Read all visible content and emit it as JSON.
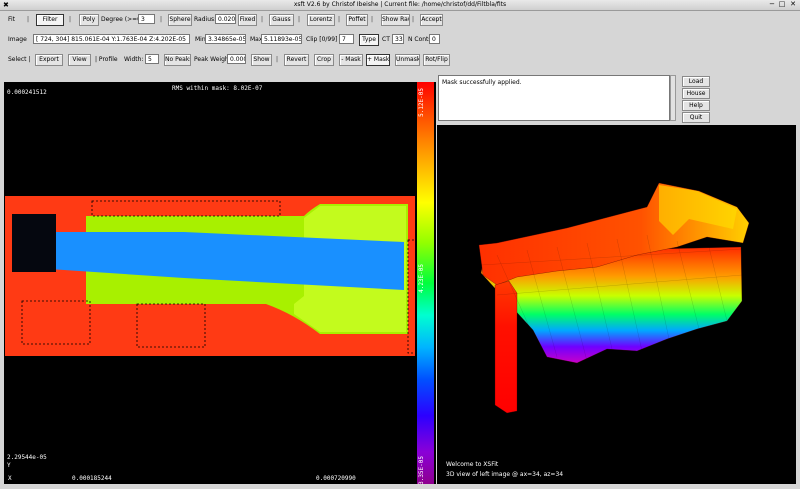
{
  "window": {
    "title": "xsft V2.6 by Christof Ibeishe   |   Current file: /home/christof/dd/Filtbla/fits",
    "min_glyph": "−",
    "max_glyph": "□",
    "close_glyph": "✕",
    "app_glyph": "✖"
  },
  "toolbar1": {
    "fit_label": "Fit",
    "filter_label": "Filter",
    "poly_label": "Poly",
    "degree_label": "Degree (>=0):",
    "degree_value": "3",
    "sphere_label": "Sphere",
    "radius_label": "Radius:",
    "radius_value": "0.020",
    "fixed_label": "Fixed",
    "gauss_label": "Gauss",
    "lorentz_label": "Lorentz",
    "poffet_label": "Poffet",
    "show_raw_label": "Show Raw",
    "accept_label": "Accept",
    "sep": "|"
  },
  "toolbar2": {
    "image_label": "Image",
    "coords_value": "[ 724, 304]  815.061E-04 Y:1.763E-04 Z:4.202E-05",
    "min_label": "Min",
    "min_value": "3.34865e-05",
    "max_label": "Max",
    "max_value": "5.11893e-05",
    "clip_label": "Clip [0/99]",
    "clip_value": "7",
    "type_label": "Type",
    "ct_label": "CT",
    "ct_value": "33",
    "ncont_label": "N Conts",
    "ncont_value": "0"
  },
  "toolbar3": {
    "select_label": "Select |",
    "export_label": "Export",
    "view_label": "View",
    "profile_label": "| Profile",
    "width_label": "Width:",
    "width_value": "5",
    "no_peaks_label": "No Peaks",
    "peak_weight_label": "Peak Weight:",
    "peak_weight_value": "0.000",
    "show_label": "Show",
    "revert_label": "Revert",
    "crop_label": "Crop",
    "minus_mask_label": "- Mask",
    "plus_mask_label": "+ Mask",
    "unmask_label": "Unmask",
    "rotflip_label": "Rot/Flip",
    "sep": "|"
  },
  "left_view": {
    "rms_text": "RMS within mask:  8.02E-07",
    "y_max": "0.000241512",
    "y_min": "2.29544e-05",
    "x_min": "0.000185244",
    "x_max": "0.000720990",
    "y_axis_letter": "Y",
    "x_axis_letter": "X",
    "colors": {
      "bg": "#ff3a14",
      "green": "#a8f000",
      "lightgreen": "#cfff2a",
      "blue": "#1990ff",
      "black": "#05070f"
    }
  },
  "colorbar": {
    "top_label": "5.12E-05",
    "mid_label": "4.23E-05",
    "bottom_label": "3.35E-05"
  },
  "messages": {
    "text": "Mask successfully applied."
  },
  "side_buttons": {
    "load": "Load",
    "house": "House",
    "help": "Help",
    "quit": "Quit"
  },
  "right_view": {
    "welcome": "Welcome to XSFit",
    "info": "3D view of left image @ ax=34, az=34"
  }
}
